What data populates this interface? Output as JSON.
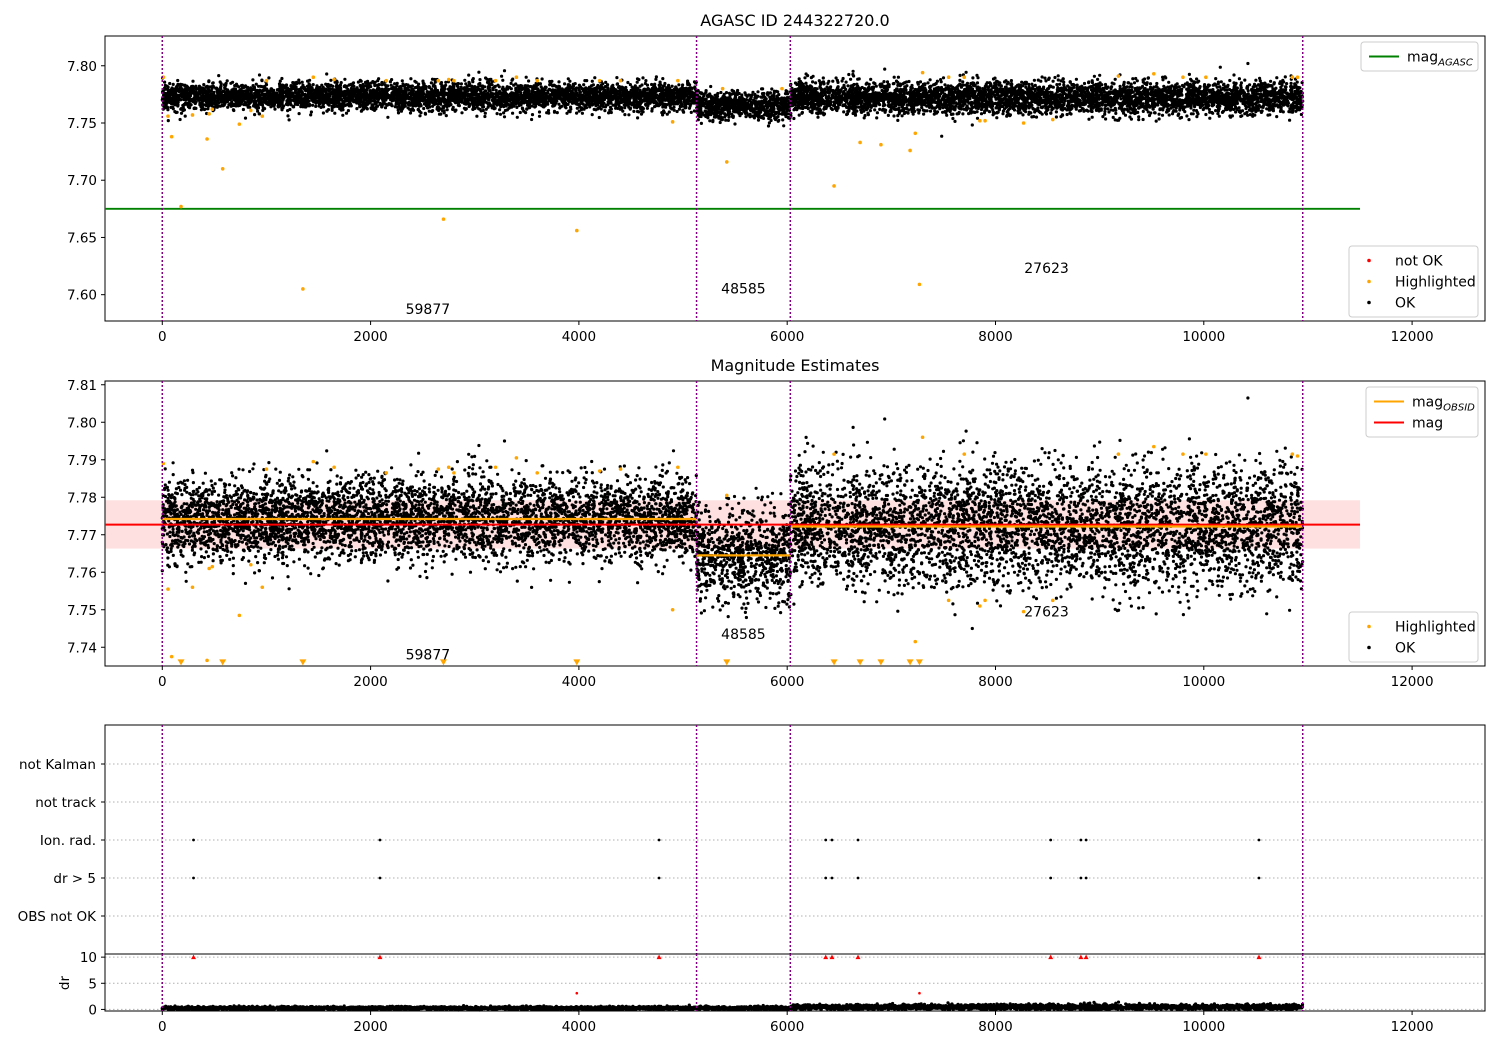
{
  "chart_data": [
    {
      "type": "scatter",
      "title": "AGASC ID 244322720.0",
      "xlim": [
        -550,
        12700
      ],
      "ylim": [
        7.577,
        7.826
      ],
      "x_ticks": [
        0,
        2000,
        4000,
        6000,
        8000,
        10000,
        12000
      ],
      "y_ticks": [
        7.6,
        7.65,
        7.7,
        7.75,
        7.8
      ],
      "y_tick_labels": [
        "7.60",
        "7.65",
        "7.70",
        "7.75",
        "7.80"
      ],
      "grid": false,
      "observation_boundaries": [
        0,
        5130,
        6030,
        10950
      ],
      "annotations": [
        {
          "text": "59877",
          "x": 2550,
          "y": 7.583
        },
        {
          "text": "48585",
          "x": 5580,
          "y": 7.601
        },
        {
          "text": "27623",
          "x": 8490,
          "y": 7.619
        }
      ],
      "lines": [
        {
          "name": "mag_AGASC",
          "y": 7.675,
          "x_range": [
            -550,
            11500
          ],
          "color": "#008000"
        }
      ],
      "legends": [
        {
          "position": "top-right",
          "entries": [
            {
              "label": "mag",
              "sub": "AGASC",
              "kind": "line",
              "color": "#008000"
            }
          ]
        },
        {
          "position": "bottom-right",
          "entries": [
            {
              "label": "not OK",
              "kind": "dot",
              "color": "#ff0000"
            },
            {
              "label": "Highlighted",
              "kind": "dot",
              "color": "#ffa500"
            },
            {
              "label": "OK",
              "kind": "dot",
              "color": "#000000"
            }
          ]
        }
      ],
      "series": [
        {
          "name": "OK",
          "color": "#000000",
          "segments": [
            {
              "x": [
                0,
                5130
              ],
              "mean": 7.773,
              "spread": 0.006
            },
            {
              "x": [
                5130,
                6030
              ],
              "mean": 7.765,
              "spread": 0.006
            },
            {
              "x": [
                6030,
                10950
              ],
              "mean": 7.772,
              "spread": 0.007
            }
          ]
        },
        {
          "name": "Highlighted",
          "color": "#ffa500",
          "x": [
            10,
            55,
            90,
            180,
            290,
            430,
            450,
            480,
            580,
            740,
            850,
            960,
            1000,
            1350,
            1450,
            1650,
            2150,
            2650,
            2700,
            2750,
            2800,
            3200,
            3400,
            3600,
            3980,
            4200,
            4400,
            4900,
            4950,
            5380,
            5420,
            5950,
            6450,
            6700,
            6900,
            7180,
            7230,
            7270,
            7300,
            7550,
            7700,
            7850,
            7900,
            8270,
            8550,
            9180,
            9520,
            9800,
            10020,
            10850,
            10900
          ],
          "y": [
            7.79,
            7.756,
            7.738,
            7.677,
            7.757,
            7.736,
            7.758,
            7.762,
            7.71,
            7.749,
            7.761,
            7.756,
            7.787,
            7.605,
            7.79,
            7.788,
            7.787,
            7.787,
            7.666,
            7.788,
            7.787,
            7.787,
            7.79,
            7.787,
            7.656,
            7.787,
            7.787,
            7.751,
            7.787,
            7.78,
            7.716,
            7.78,
            7.695,
            7.733,
            7.731,
            7.726,
            7.741,
            7.609,
            7.794,
            7.79,
            7.79,
            7.752,
            7.752,
            7.75,
            7.753,
            7.791,
            7.793,
            7.79,
            7.79,
            7.79,
            7.79
          ]
        },
        {
          "name": "not OK",
          "color": "#ff0000",
          "x": [],
          "y": []
        }
      ]
    },
    {
      "type": "scatter",
      "title": "Magnitude Estimates",
      "xlim": [
        -550,
        12700
      ],
      "ylim": [
        7.735,
        7.811
      ],
      "x_ticks": [
        0,
        2000,
        4000,
        6000,
        8000,
        10000,
        12000
      ],
      "y_ticks": [
        7.74,
        7.75,
        7.76,
        7.77,
        7.78,
        7.79,
        7.8,
        7.81
      ],
      "y_tick_labels": [
        "7.74",
        "7.75",
        "7.76",
        "7.77",
        "7.78",
        "7.79",
        "7.80",
        "7.81"
      ],
      "grid": false,
      "observation_boundaries": [
        0,
        5130,
        6030,
        10950
      ],
      "annotations": [
        {
          "text": "59877",
          "x": 2550,
          "y": 7.7368
        },
        {
          "text": "48585",
          "x": 5580,
          "y": 7.7422
        },
        {
          "text": "27623",
          "x": 8490,
          "y": 7.7482
        }
      ],
      "band": {
        "x_range": [
          -550,
          11500
        ],
        "y_range": [
          7.7663,
          7.7792
        ],
        "color": "#ff0000",
        "opacity": 0.12
      },
      "lines": [
        {
          "name": "mag",
          "y": 7.7727,
          "x_range": [
            -550,
            11500
          ],
          "color": "#ff0000"
        },
        {
          "name": "mag_OBSID",
          "color": "#ffa500",
          "steps": [
            {
              "x": [
                0,
                5130
              ],
              "y": 7.7742
            },
            {
              "x": [
                5130,
                6030
              ],
              "y": 7.7645
            },
            {
              "x": [
                6030,
                10950
              ],
              "y": 7.7722
            }
          ]
        }
      ],
      "legends": [
        {
          "position": "top-right",
          "entries": [
            {
              "label": "mag",
              "sub": "OBSID",
              "kind": "line",
              "color": "#ffa500"
            },
            {
              "label": "mag",
              "kind": "line",
              "color": "#ff0000"
            }
          ]
        },
        {
          "position": "bottom-right",
          "entries": [
            {
              "label": "Highlighted",
              "kind": "dot",
              "color": "#ffa500"
            },
            {
              "label": "OK",
              "kind": "dot",
              "color": "#000000"
            }
          ]
        }
      ],
      "series": [
        {
          "name": "OK",
          "color": "#000000",
          "segments": [
            {
              "x": [
                0,
                5130
              ],
              "mean": 7.7742,
              "spread": 0.0055
            },
            {
              "x": [
                5130,
                6030
              ],
              "mean": 7.7645,
              "spread": 0.006
            },
            {
              "x": [
                6030,
                10950
              ],
              "mean": 7.7722,
              "spread": 0.008
            }
          ]
        },
        {
          "name": "Highlighted",
          "color": "#ffa500",
          "x": [
            10,
            55,
            90,
            290,
            430,
            450,
            480,
            740,
            850,
            960,
            1000,
            1450,
            1650,
            2150,
            2650,
            2750,
            2800,
            3200,
            3400,
            3600,
            4200,
            4400,
            4900,
            4950,
            5420,
            6450,
            7230,
            7300,
            7550,
            7700,
            7850,
            7900,
            8270,
            8550,
            9180,
            9520,
            9800,
            10020,
            10850,
            10900
          ],
          "y": [
            7.789,
            7.7555,
            7.7375,
            7.756,
            7.7365,
            7.761,
            7.7615,
            7.7485,
            7.762,
            7.756,
            7.7875,
            7.7895,
            7.788,
            7.7865,
            7.7875,
            7.788,
            7.7865,
            7.788,
            7.7905,
            7.7865,
            7.787,
            7.7875,
            7.75,
            7.788,
            7.7805,
            7.7915,
            7.7415,
            7.796,
            7.7525,
            7.7915,
            7.751,
            7.7525,
            7.7495,
            7.7525,
            7.7915,
            7.7935,
            7.7915,
            7.7915,
            7.7915,
            7.791
          ]
        },
        {
          "name": "Highlighted below range",
          "color": "#ffa500",
          "marker": "triangle-down",
          "x": [
            180,
            580,
            1350,
            2700,
            3980,
            5420,
            6450,
            6700,
            6900,
            7180,
            7270
          ],
          "y": [
            7.7357,
            7.7357,
            7.7357,
            7.7357,
            7.7357,
            7.7357,
            7.7357,
            7.7357,
            7.7357,
            7.7357,
            7.7357
          ]
        }
      ]
    },
    {
      "type": "scatter",
      "title": "",
      "xlim": [
        -550,
        12700
      ],
      "categories": [
        "OBS not OK",
        "dr > 5",
        "Ion. rad.",
        "not track",
        "not Kalman"
      ],
      "grid": true,
      "observation_boundaries": [
        0,
        5130,
        6030,
        10950
      ],
      "series": [
        {
          "name": "dr > 5",
          "color": "#000000",
          "x": [
            300,
            2090,
            4770,
            6370,
            6430,
            6680,
            8530,
            8820,
            8870,
            10530
          ]
        },
        {
          "name": "Ion. rad.",
          "color": "#000000",
          "x": [
            300,
            2090,
            4770,
            6370,
            6430,
            6680,
            8530,
            8820,
            8870,
            10530
          ]
        },
        {
          "name": "OBS not OK",
          "color": "#000000",
          "x": []
        },
        {
          "name": "not track",
          "color": "#000000",
          "x": []
        },
        {
          "name": "not Kalman",
          "color": "#000000",
          "x": []
        }
      ]
    },
    {
      "type": "scatter",
      "ylabel": "dr",
      "xlim": [
        -550,
        12700
      ],
      "ylim": [
        -0.3,
        10.6
      ],
      "x_ticks": [
        0,
        2000,
        4000,
        6000,
        8000,
        10000,
        12000
      ],
      "y_ticks": [
        0,
        5,
        10
      ],
      "grid": true,
      "observation_boundaries": [
        0,
        5130,
        6030,
        10950
      ],
      "series": [
        {
          "name": "dr",
          "color": "#000000",
          "segments": [
            {
              "x": [
                0,
                6030
              ],
              "mean": 0.25,
              "spread": 0.15
            },
            {
              "x": [
                6030,
                10950
              ],
              "mean": 0.45,
              "spread": 0.25
            }
          ]
        },
        {
          "name": "dr > 5 (clipped)",
          "color": "#ff0000",
          "marker": "triangle-up",
          "x": [
            300,
            2090,
            4770,
            6370,
            6430,
            6680,
            8530,
            8820,
            8870,
            10530
          ],
          "y": [
            10,
            10,
            10,
            10,
            10,
            10,
            10,
            10,
            10,
            10
          ]
        },
        {
          "name": "dr outliers",
          "color": "#ff0000",
          "x": [
            3980,
            7270
          ],
          "y": [
            3.1,
            3.1
          ]
        }
      ]
    }
  ]
}
